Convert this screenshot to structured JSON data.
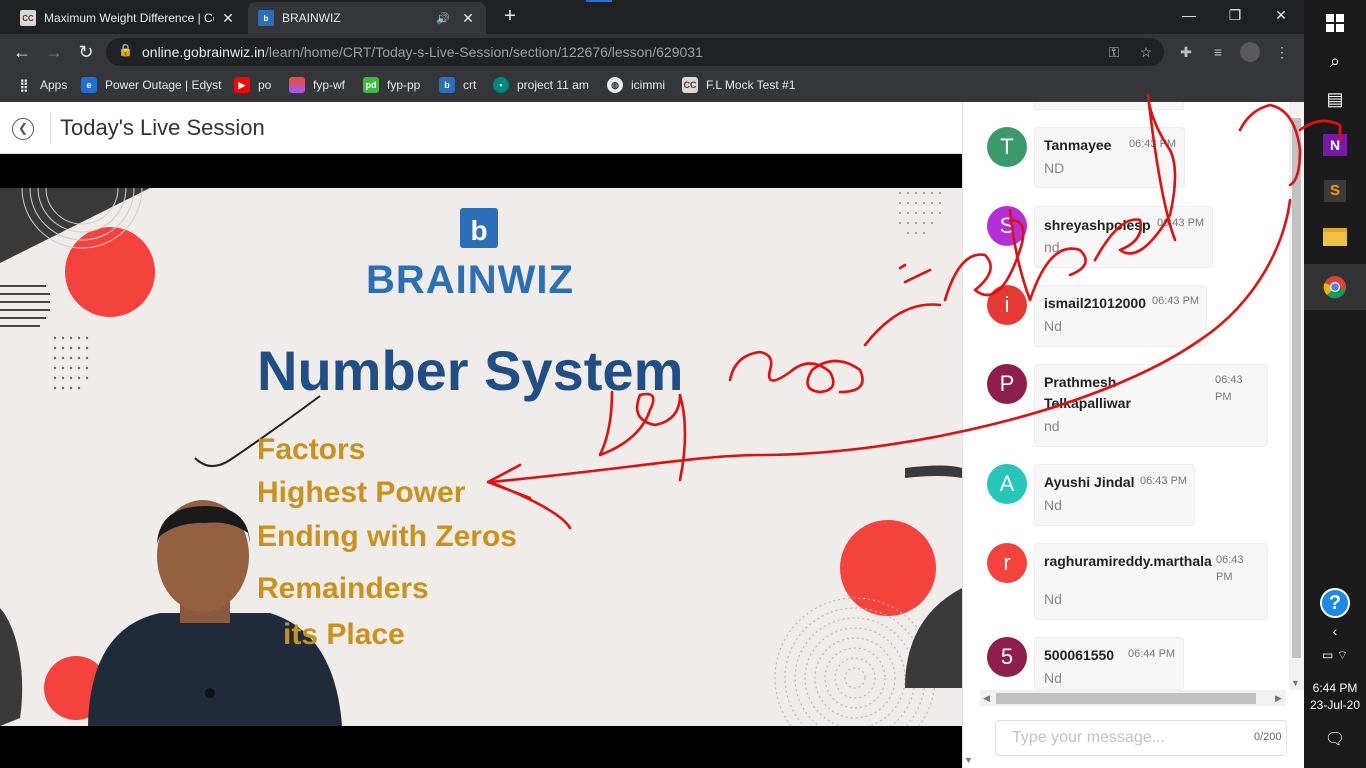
{
  "browser": {
    "tabs": [
      {
        "title": "Maximum Weight Difference | Co",
        "favicon": "CC",
        "active": false
      },
      {
        "title": "BRAINWIZ",
        "favicon": "b",
        "active": true
      }
    ],
    "url_host": "online.gobrainwiz.in",
    "url_path": "/learn/home/CRT/Today-s-Live-Session/section/122676/lesson/629031"
  },
  "bookmarks": [
    {
      "label": "Apps",
      "icon": "apps-grid-icon"
    },
    {
      "label": "Power Outage | Edyst",
      "icon": "edyst-icon"
    },
    {
      "label": "po",
      "icon": "youtube-icon"
    },
    {
      "label": "fyp-wf",
      "icon": "figma-icon"
    },
    {
      "label": "fyp-pp",
      "icon": "pd-icon"
    },
    {
      "label": "crt",
      "icon": "brainwiz-icon"
    },
    {
      "label": "project 11 am",
      "icon": "meet-icon"
    },
    {
      "label": "icimmi",
      "icon": "globe-icon"
    },
    {
      "label": "F.L Mock Test #1",
      "icon": "cc-icon"
    }
  ],
  "page": {
    "title": "Today's Live Session"
  },
  "slide": {
    "brand": "BRAINWIZ",
    "heading": "Number System",
    "topics": [
      "Factors",
      "Highest Power",
      "Ending with Zeros",
      "Remainders",
      "its Place"
    ]
  },
  "chat": {
    "messages": [
      {
        "initial": "T",
        "color": "#3a9a6e",
        "user": "Tanmayee",
        "time": "06:43 PM",
        "text": "ND"
      },
      {
        "initial": "S",
        "color": "#b52fd6",
        "user": "shreyashpolesp",
        "time": "06:43 PM",
        "text": "nd"
      },
      {
        "initial": "i",
        "color": "#e53935",
        "user": "ismail21012000",
        "time": "06:43 PM",
        "text": "Nd"
      },
      {
        "initial": "P",
        "color": "#8e1f4a",
        "user": "Prathmesh Telkapalliwar",
        "time": "06:43 PM",
        "text": "nd"
      },
      {
        "initial": "A",
        "color": "#26c6b8",
        "user": "Ayushi Jindal",
        "time": "06:43 PM",
        "text": "Nd"
      },
      {
        "initial": "r",
        "color": "#f4433c",
        "user": "raghuramireddy.marthala",
        "time": "06:43 PM",
        "text": "Nd"
      },
      {
        "initial": "5",
        "color": "#8e1f4a",
        "user": "500061550",
        "time": "06:44 PM",
        "text": "Nd"
      }
    ],
    "input_placeholder": "Type your message...",
    "char_count": "0/200"
  },
  "taskbar": {
    "time": "6:44 PM",
    "date": "23-Jul-20"
  }
}
